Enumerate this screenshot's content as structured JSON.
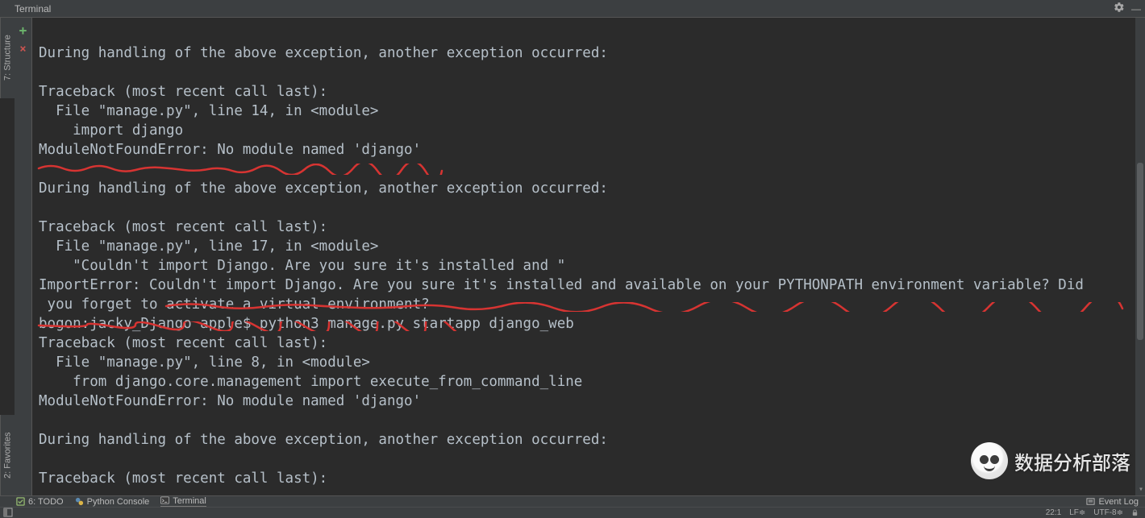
{
  "top": {
    "tab_label": "Terminal"
  },
  "side_tabs": {
    "structure": "7: Structure",
    "favorites": "2: Favorites"
  },
  "gutter": {
    "add_symbol": "+",
    "close_symbol": "×"
  },
  "terminal_output": [
    "",
    "During handling of the above exception, another exception occurred:",
    "",
    "Traceback (most recent call last):",
    "  File \"manage.py\", line 14, in <module>",
    "    import django",
    "ModuleNotFoundError: No module named 'django'",
    "",
    "During handling of the above exception, another exception occurred:",
    "",
    "Traceback (most recent call last):",
    "  File \"manage.py\", line 17, in <module>",
    "    \"Couldn't import Django. Are you sure it's installed and \"",
    "ImportError: Couldn't import Django. Are you sure it's installed and available on your PYTHONPATH environment variable? Did",
    " you forget to activate a virtual environment?",
    "bogon:jacky_Django apple$ python3 manage.py startapp django_web",
    "Traceback (most recent call last):",
    "  File \"manage.py\", line 8, in <module>",
    "    from django.core.management import execute_from_command_line",
    "ModuleNotFoundError: No module named 'django'",
    "",
    "During handling of the above exception, another exception occurred:",
    "",
    "Traceback (most recent call last):"
  ],
  "bottom": {
    "todo": "6: TODO",
    "python_console": "Python Console",
    "terminal": "Terminal",
    "event_log": "Event Log"
  },
  "status": {
    "caret": "22:1",
    "line_sep": "LF",
    "encoding": "UTF-8"
  },
  "watermark": {
    "text": "数据分析部落"
  }
}
